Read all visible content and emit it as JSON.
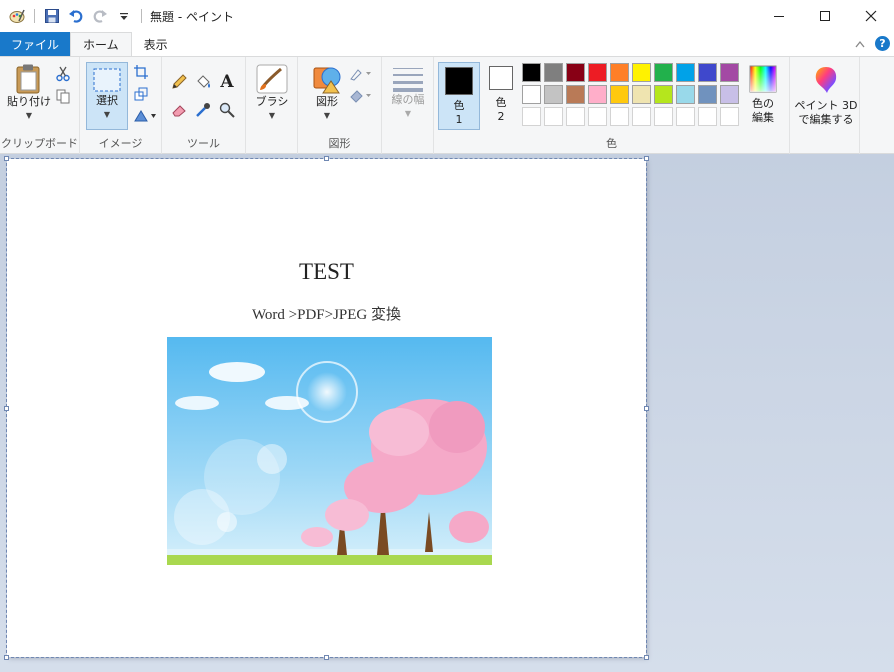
{
  "window": {
    "title": "無題 - ペイント"
  },
  "tabs": [
    {
      "label": "ファイル"
    },
    {
      "label": "ホーム"
    },
    {
      "label": "表示"
    }
  ],
  "ribbon": {
    "clipboard": {
      "paste_label": "貼り付け",
      "group_label": "クリップボード"
    },
    "image": {
      "select_label": "選択",
      "group_label": "イメージ"
    },
    "tools": {
      "group_label": "ツール",
      "text_icon": "A"
    },
    "brush": {
      "label": "ブラシ"
    },
    "shapes": {
      "label": "図形",
      "group_label": "図形"
    },
    "size": {
      "label": "線の幅"
    },
    "color1": {
      "label": "色",
      "sub": "1"
    },
    "color2": {
      "label": "色",
      "sub": "2"
    },
    "colors": {
      "group_label": "色",
      "row1": [
        "#000000",
        "#7f7f7f",
        "#880015",
        "#ed1c24",
        "#ff7f27",
        "#fff200",
        "#22b14c",
        "#00a2e8",
        "#3f48cc",
        "#a349a4"
      ],
      "row2": [
        "#ffffff",
        "#c3c3c3",
        "#b97a57",
        "#ffaec9",
        "#ffc90e",
        "#efe4b0",
        "#b5e61d",
        "#99d9ea",
        "#7092be",
        "#c8bfe7"
      ],
      "edit_label_1": "色の",
      "edit_label_2": "編集"
    },
    "paint3d": {
      "label_1": "ペイント 3D",
      "label_2": "で編集する"
    }
  },
  "canvas": {
    "doc_title": "TEST",
    "doc_subtitle": "Word >PDF>JPEG 変換"
  }
}
